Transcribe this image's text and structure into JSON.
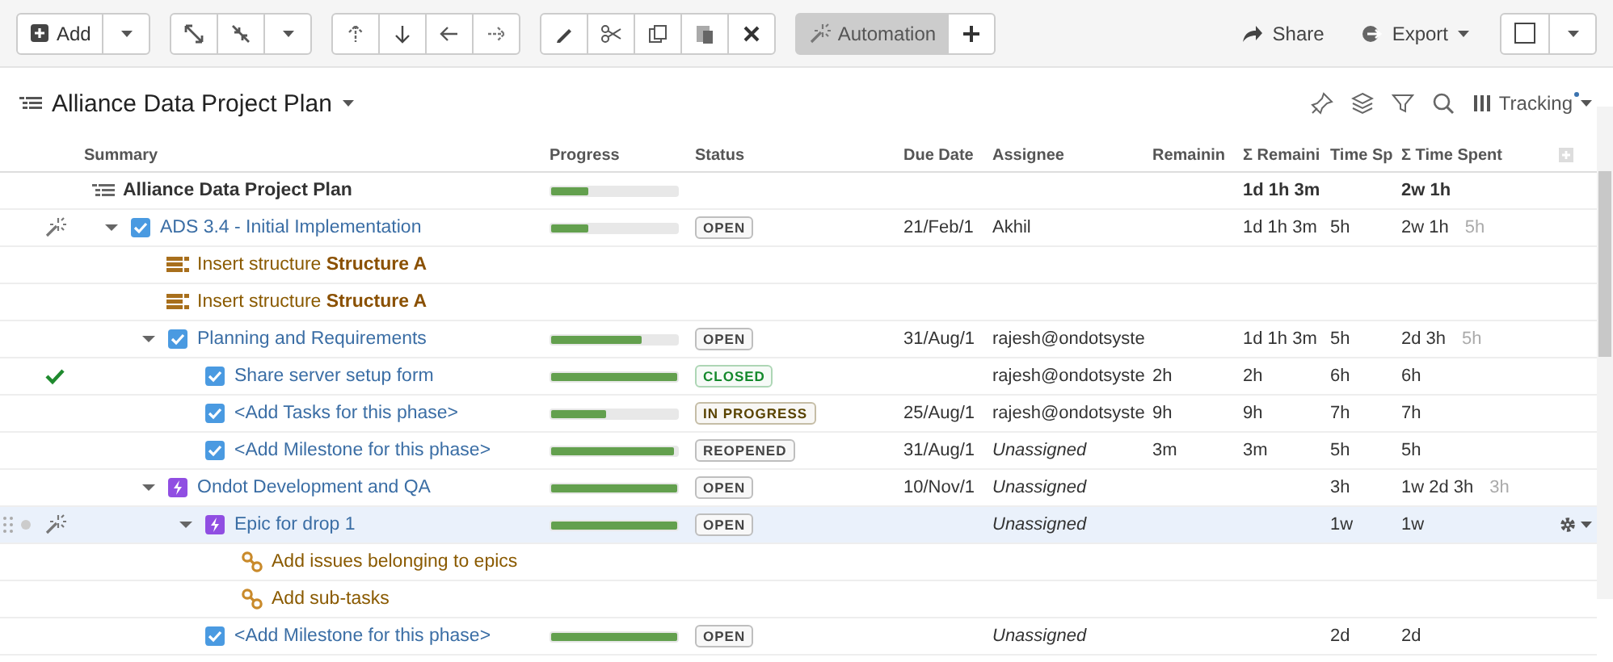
{
  "toolbar": {
    "add": "Add",
    "automation": {
      "label": "Automation",
      "on": true
    },
    "share": "Share",
    "export": "Export"
  },
  "header": {
    "title": "Alliance Data Project Plan",
    "view": {
      "label": "Tracking",
      "modified": true
    }
  },
  "columns": [
    "Summary",
    "Progress",
    "Status",
    "Due Date",
    "Assignee",
    "Remainin",
    "Σ Remaini",
    "Time Sp",
    "Σ Time Spent"
  ],
  "rows": [
    {
      "kind": "root",
      "summary": "Alliance Data Project Plan",
      "level": 0.3,
      "sum_remaining": "1d 1h 3m",
      "sum_time_spent": "2w 1h",
      "selected": false,
      "automated": false,
      "done": false,
      "children": [
        {
          "kind": "task",
          "automated": true,
          "done": false,
          "expanded": true,
          "selected": false,
          "summary": "ADS 3.4 - Initial Implementation",
          "level": 0.3,
          "status": "OPEN",
          "color": "#444444",
          "due": "21/Feb/1",
          "assignee": "Akhil",
          "assigned": true,
          "sum_remaining": "1d 1h 3m",
          "time_spent": "5h",
          "sum_time_spent": "2w 1h",
          "time_note": "5h",
          "children": [
            {
              "kind": "insert",
              "automated": false,
              "done": false,
              "selected": false,
              "summary": "Insert structure **Structure A**"
            },
            {
              "kind": "insert",
              "automated": false,
              "done": false,
              "selected": false,
              "summary": "Insert structure **Structure A**"
            },
            {
              "kind": "task",
              "automated": false,
              "done": false,
              "expanded": true,
              "selected": false,
              "summary": "Planning and Requirements",
              "level": 0.72,
              "status": "OPEN",
              "color": "#444444",
              "due": "31/Aug/1",
              "assignee": "rajesh@ondotsyste",
              "assigned": true,
              "sum_remaining": "1d 1h 3m",
              "time_spent": "5h",
              "sum_time_spent": "2d 3h",
              "time_note": "5h",
              "children": [
                {
                  "kind": "task",
                  "automated": false,
                  "done": true,
                  "selected": false,
                  "summary": "Share server setup form",
                  "level": 1,
                  "status": "CLOSED",
                  "color": "#14892c",
                  "assignee": "rajesh@ondotsyste",
                  "assigned": true,
                  "remaining": "2h",
                  "sum_remaining": "2h",
                  "time_spent": "6h",
                  "sum_time_spent": "6h"
                },
                {
                  "kind": "task",
                  "automated": false,
                  "done": false,
                  "selected": false,
                  "summary": "<Add Tasks for this phase>",
                  "level": 0.43,
                  "status": "IN PROGRESS",
                  "color": "#594300",
                  "due": "25/Aug/1",
                  "assignee": "rajesh@ondotsyste",
                  "assigned": true,
                  "remaining": "9h",
                  "sum_remaining": "9h",
                  "time_spent": "7h",
                  "sum_time_spent": "7h"
                },
                {
                  "kind": "task",
                  "automated": false,
                  "done": false,
                  "selected": false,
                  "summary": "<Add Milestone for this phase>",
                  "level": 0.97,
                  "status": "REOPENED",
                  "color": "#444444",
                  "due": "31/Aug/1",
                  "assignee": "Unassigned",
                  "assigned": false,
                  "remaining": "3m",
                  "sum_remaining": "3m",
                  "time_spent": "5h",
                  "sum_time_spent": "5h"
                }
              ]
            },
            {
              "kind": "epic",
              "automated": false,
              "done": false,
              "expanded": true,
              "selected": false,
              "summary": "Ondot Development and QA",
              "level": 1,
              "status": "OPEN",
              "color": "#444444",
              "due": "10/Nov/1",
              "assignee": "Unassigned",
              "assigned": false,
              "time_spent": "3h",
              "sum_time_spent": "1w 2d 3h",
              "time_note": "3h",
              "children": [
                {
                  "kind": "epic",
                  "automated": true,
                  "done": false,
                  "expanded": true,
                  "selected": true,
                  "summary": "Epic for drop 1",
                  "level": 1,
                  "status": "OPEN",
                  "color": "#444444",
                  "assignee": "Unassigned",
                  "assigned": false,
                  "time_spent": "1w",
                  "sum_time_spent": "1w",
                  "children": [
                    {
                      "kind": "link",
                      "automated": false,
                      "done": false,
                      "selected": false,
                      "summary": "Add issues belonging to epics"
                    },
                    {
                      "kind": "link",
                      "automated": false,
                      "done": false,
                      "selected": false,
                      "summary": "Add sub-tasks"
                    }
                  ]
                },
                {
                  "kind": "task",
                  "automated": false,
                  "done": false,
                  "selected": false,
                  "summary": "<Add Milestone for this phase>",
                  "level": 1,
                  "status": "OPEN",
                  "color": "#444444",
                  "assignee": "Unassigned",
                  "assigned": false,
                  "time_spent": "2d",
                  "sum_time_spent": "2d"
                }
              ]
            }
          ]
        }
      ]
    }
  ]
}
